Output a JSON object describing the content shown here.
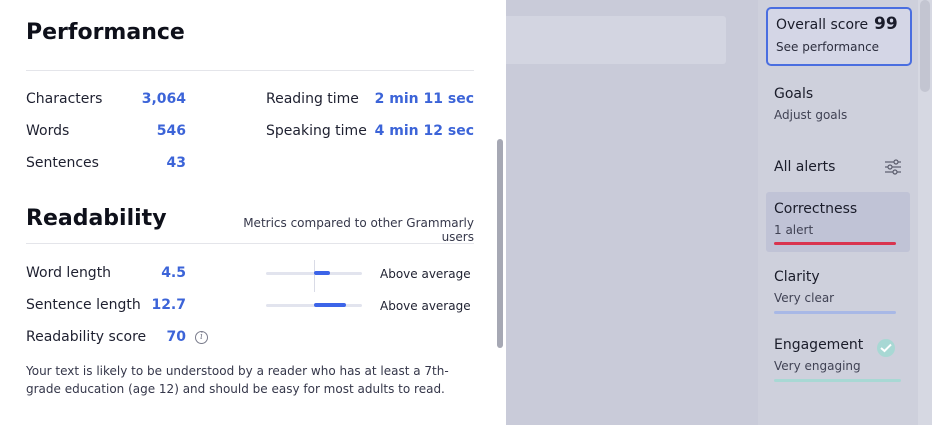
{
  "performance": {
    "title": "Performance",
    "stats": [
      {
        "label": "Characters",
        "value": "3,064"
      },
      {
        "label": "Words",
        "value": "546"
      },
      {
        "label": "Sentences",
        "value": "43"
      }
    ],
    "times": [
      {
        "label": "Reading time",
        "value": "2 min 11 sec"
      },
      {
        "label": "Speaking time",
        "value": "4 min 12 sec"
      }
    ]
  },
  "readability": {
    "title": "Readability",
    "note": "Metrics compared to other Grammarly users",
    "metrics": [
      {
        "label": "Word length",
        "value": "4.5",
        "rating": "Above average",
        "meter_level": 0.6
      },
      {
        "label": "Sentence length",
        "value": "12.7",
        "rating": "Above average",
        "meter_level": 0.8
      },
      {
        "label": "Readability score",
        "value": "70"
      }
    ],
    "description": "Your text is likely to be understood by a reader who has at least a 7th-grade education (age 12) and should be easy for most adults to read."
  },
  "sidebar": {
    "overall_label": "Overall score",
    "overall_value": "99",
    "overall_sub": "See performance",
    "goals_label": "Goals",
    "goals_sub": "Adjust goals",
    "all_alerts": "All alerts",
    "correctness": {
      "label": "Correctness",
      "sub": "1 alert",
      "color": "#d9344f"
    },
    "clarity": {
      "label": "Clarity",
      "sub": "Very clear",
      "color": "#a8b8e6"
    },
    "engagement": {
      "label": "Engagement",
      "sub": "Very engaging",
      "color": "#a8d8d4"
    }
  },
  "colors": {
    "accent": "#3c64d8",
    "panel_bg": "#ffffff",
    "overlay_bg": "#c9cbd9"
  }
}
